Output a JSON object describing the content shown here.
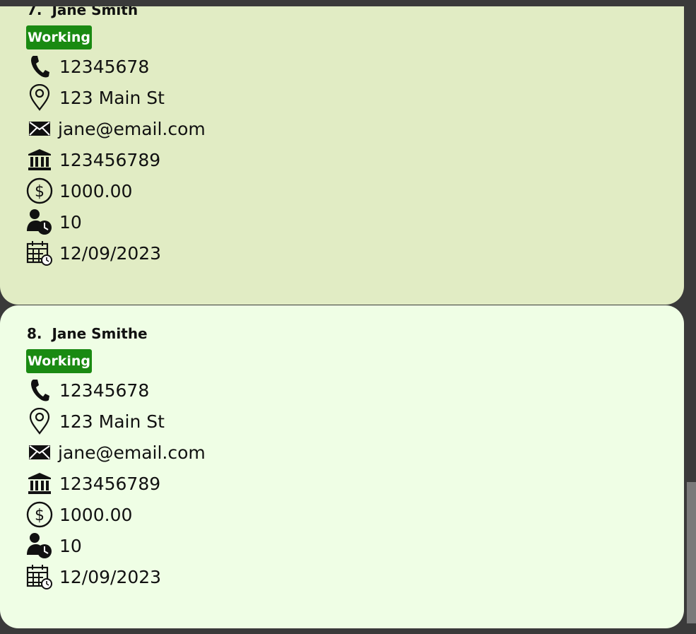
{
  "persons": [
    {
      "index": "7.",
      "name": "Jane Smith",
      "status": "Working",
      "phone": "12345678",
      "address": "123 Main St",
      "email": "jane@email.com",
      "bank_account": "123456789",
      "salary": "1000.00",
      "leave": "10",
      "date": "12/09/2023"
    },
    {
      "index": "8.",
      "name": "Jane Smithe",
      "status": "Working",
      "phone": "12345678",
      "address": "123 Main St",
      "email": "jane@email.com",
      "bank_account": "123456789",
      "salary": "1000.00",
      "leave": "10",
      "date": "12/09/2023"
    }
  ],
  "icons": {
    "phone": "phone-icon",
    "address": "location-pin-icon",
    "email": "envelope-icon",
    "bank_account": "bank-icon",
    "salary": "dollar-icon",
    "leave": "person-clock-icon",
    "date": "calendar-clock-icon"
  },
  "colors": {
    "card_selected": "#e1ecc4",
    "card_default": "#effee5",
    "status_working": "#1a8a12",
    "background": "#3a3a3a"
  }
}
